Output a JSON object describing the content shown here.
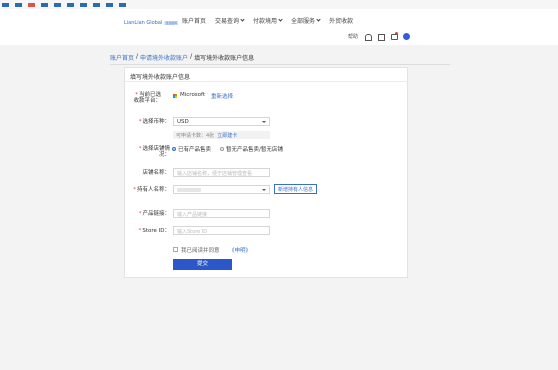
{
  "bookmarks": [
    "",
    "",
    "",
    "",
    "",
    "",
    "",
    "",
    "",
    "",
    ""
  ],
  "brand": {
    "name": "LianLian Global",
    "tag": "连连国际"
  },
  "nav": {
    "items": [
      {
        "label": "账户首页",
        "has_menu": false
      },
      {
        "label": "交易查询",
        "has_menu": true
      },
      {
        "label": "付款境用",
        "has_menu": true
      },
      {
        "label": "全部服务",
        "has_menu": true
      },
      {
        "label": "外贸收款",
        "has_menu": false
      }
    ]
  },
  "tools": {
    "help_label": "帮助"
  },
  "breadcrumb": {
    "items": [
      "账户首页",
      "申请境外收款账户",
      "填写境外收款账户信息"
    ],
    "separator": "/"
  },
  "form": {
    "title": "填写境外收款账户信息",
    "platform": {
      "label": "当前已选收款平台：",
      "value": "Microsoft",
      "reselect": "重新选择"
    },
    "currency": {
      "label": "选择币种：",
      "value": "USD",
      "hint": "可申请卡数：4张",
      "hint_link": "立即建卡"
    },
    "store_status": {
      "label": "选择店铺情况：",
      "option_a": "已有产品售卖",
      "option_b": "暂无产品售卖/暂无店铺"
    },
    "store_name": {
      "label": "店铺名称：",
      "placeholder": "输入店铺名称，便于店铺管理查看"
    },
    "holder": {
      "label": "持有人名称：",
      "button": "新增持有人信息"
    },
    "product_link": {
      "label": "产品链接：",
      "placeholder": "输入产品链接"
    },
    "store_id": {
      "label": "Store ID：",
      "placeholder": "输入Store ID"
    },
    "agree": {
      "text": "我已阅读并同意",
      "link": "《申明》"
    },
    "submit": "提交"
  },
  "colors": {
    "accent": "#2b57c9",
    "link": "#3a6fc7",
    "required": "#e2463b"
  },
  "icons": [
    "help-icon",
    "bell-icon",
    "gift-icon",
    "message-icon",
    "user-avatar-icon"
  ]
}
